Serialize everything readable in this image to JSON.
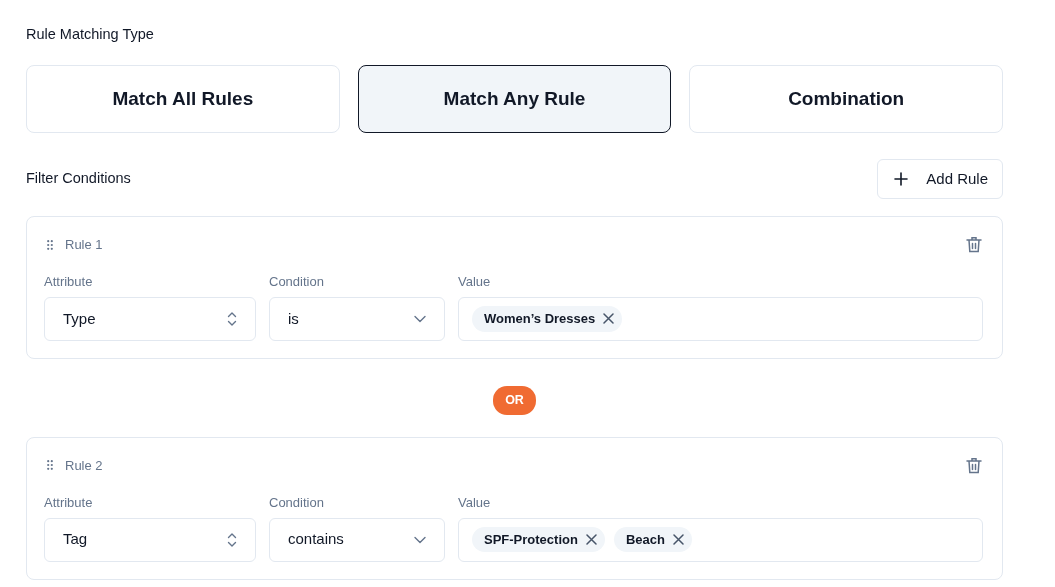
{
  "heading": "Rule Matching Type",
  "match_types": [
    {
      "label": "Match All Rules",
      "selected": false
    },
    {
      "label": "Match Any Rule",
      "selected": true
    },
    {
      "label": "Combination",
      "selected": false
    }
  ],
  "filter_heading": "Filter Conditions",
  "add_button": {
    "label": "Add Rule"
  },
  "rules": [
    {
      "title": "Rule 1",
      "fields": [
        {
          "label": "Attribute",
          "kind": "select",
          "value": "Type"
        },
        {
          "label": "Condition",
          "kind": "dropdown",
          "value": "is"
        },
        {
          "label": "Value",
          "kind": "tags",
          "tags": [
            "Women’s Dresses"
          ]
        }
      ]
    },
    {
      "joiner": "OR",
      "title": "Rule 2",
      "fields": [
        {
          "label": "Attribute",
          "kind": "select",
          "value": "Tag"
        },
        {
          "label": "Condition",
          "kind": "dropdown",
          "value": "contains"
        },
        {
          "label": "Value",
          "kind": "tags",
          "tags": [
            "SPF-Protection",
            "Beach"
          ]
        }
      ]
    }
  ]
}
